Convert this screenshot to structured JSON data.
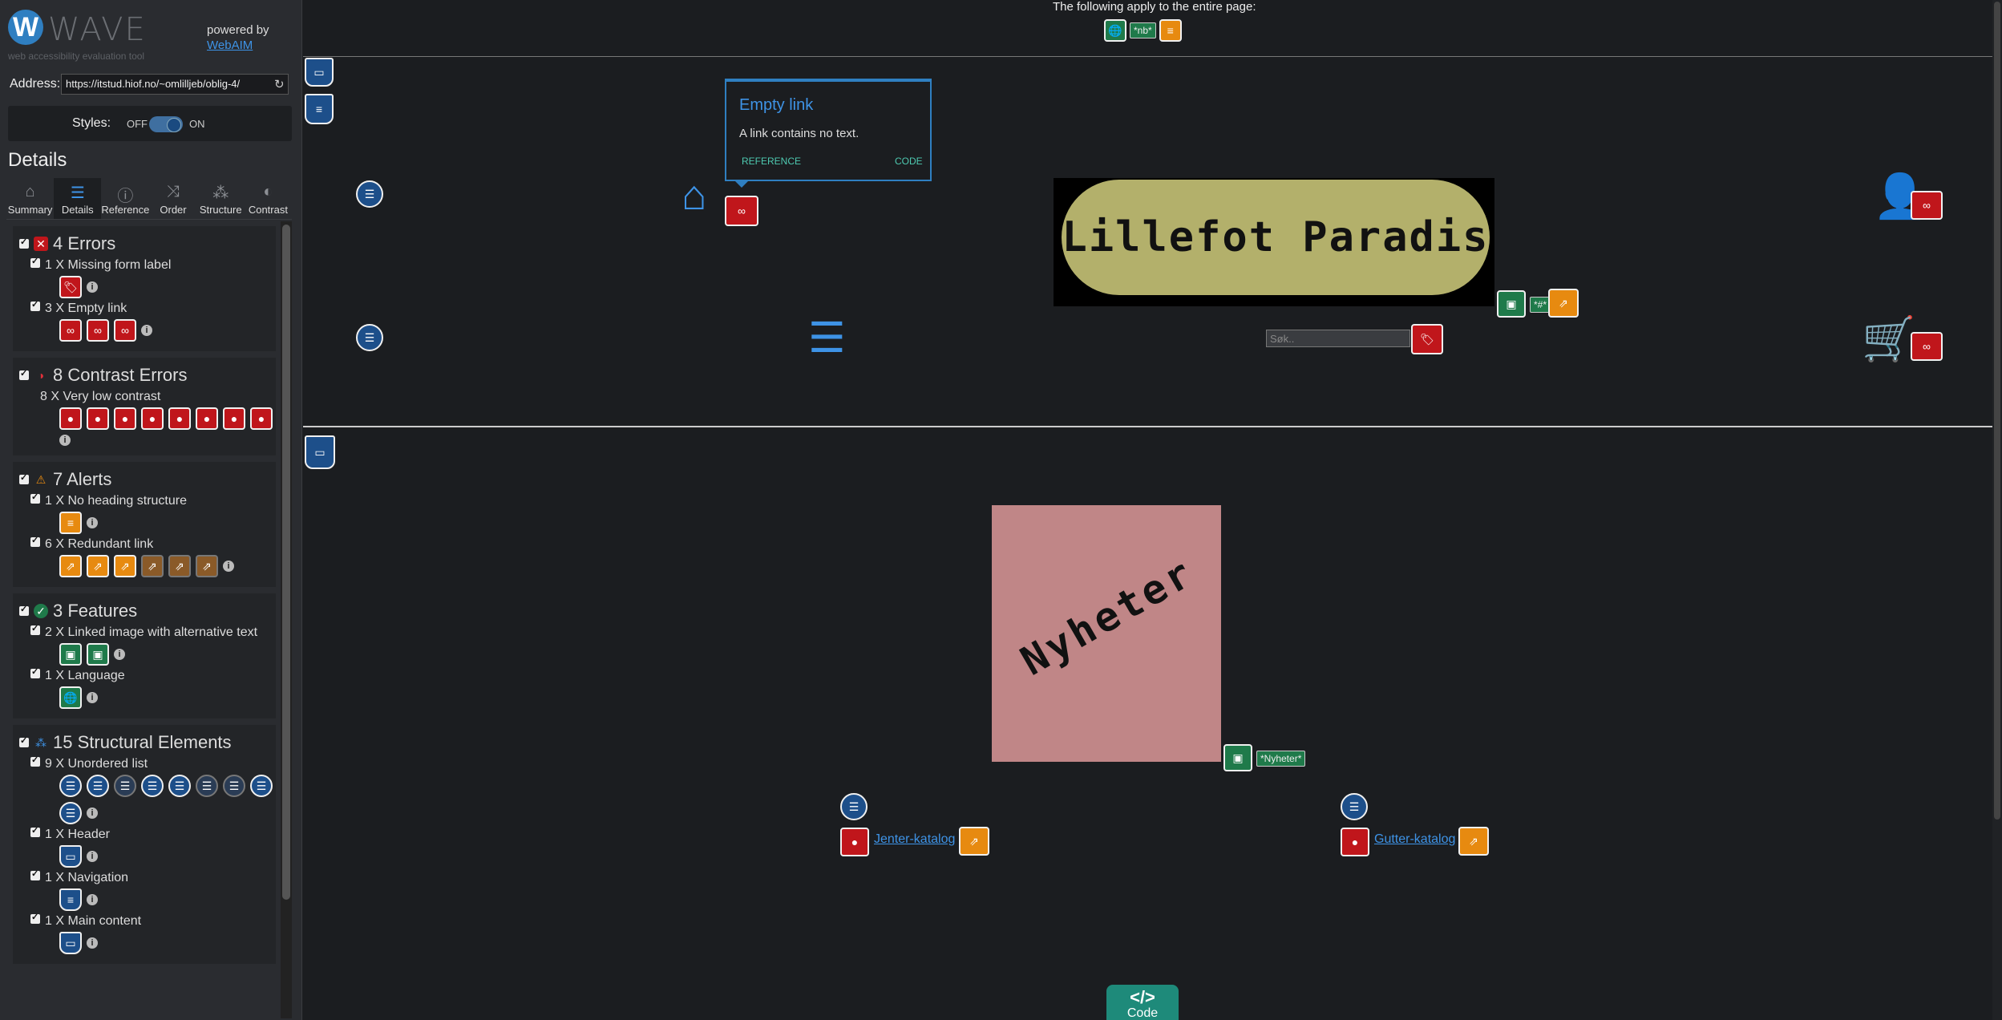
{
  "sidebar": {
    "logo_letter": "W",
    "logo_word": "WAVE",
    "logo_sub": "web accessibility evaluation tool",
    "powered_by": "powered by",
    "webaim": "WebAIM",
    "address_label": "Address:",
    "address_value": "https://itstud.hiof.no/~omlilljeb/oblig-4/",
    "styles_label": "Styles:",
    "styles_off": "OFF",
    "styles_on": "ON",
    "details_title": "Details",
    "tabs": [
      {
        "label": "Summary",
        "icon": "home-icon"
      },
      {
        "label": "Details",
        "icon": "list-icon"
      },
      {
        "label": "Reference",
        "icon": "info-icon"
      },
      {
        "label": "Order",
        "icon": "order-icon"
      },
      {
        "label": "Structure",
        "icon": "structure-icon"
      },
      {
        "label": "Contrast",
        "icon": "contrast-icon"
      }
    ],
    "sections": {
      "errors": {
        "title": "4 Errors",
        "items": [
          "1 X Missing form label",
          "3 X Empty link"
        ]
      },
      "contrast": {
        "title": "8 Contrast Errors",
        "items": [
          "8 X Very low contrast"
        ]
      },
      "alerts": {
        "title": "7 Alerts",
        "items": [
          "1 X No heading structure",
          "6 X Redundant link"
        ]
      },
      "features": {
        "title": "3 Features",
        "items": [
          "2 X Linked image with alternative text",
          "1 X Language"
        ]
      },
      "structure": {
        "title": "15 Structural Elements",
        "items": [
          "9 X Unordered list",
          "1 X Header",
          "1 X Navigation",
          "1 X Main content"
        ]
      }
    }
  },
  "main": {
    "page_note": "The following apply to the entire page:",
    "lang_tag": "*nb*",
    "popup": {
      "title": "Empty link",
      "description": "A link contains no text.",
      "reference": "REFERENCE",
      "code": "CODE"
    },
    "banner_text": "Lillefot Paradis",
    "banner_alt_tag": "*#*",
    "search_placeholder": "Søk..",
    "news_text": "Nyheter",
    "news_alt_tag": "*Nyheter*",
    "link_girls": "Jenter-katalog",
    "link_boys": "Gutter-katalog",
    "code_button": "Code"
  },
  "colors": {
    "accent": "#3e93e6",
    "error": "#c0161b",
    "alert": "#e78a10",
    "feature": "#1f7a4a",
    "structure": "#1d4f8a",
    "teal": "#1e8a7a"
  }
}
